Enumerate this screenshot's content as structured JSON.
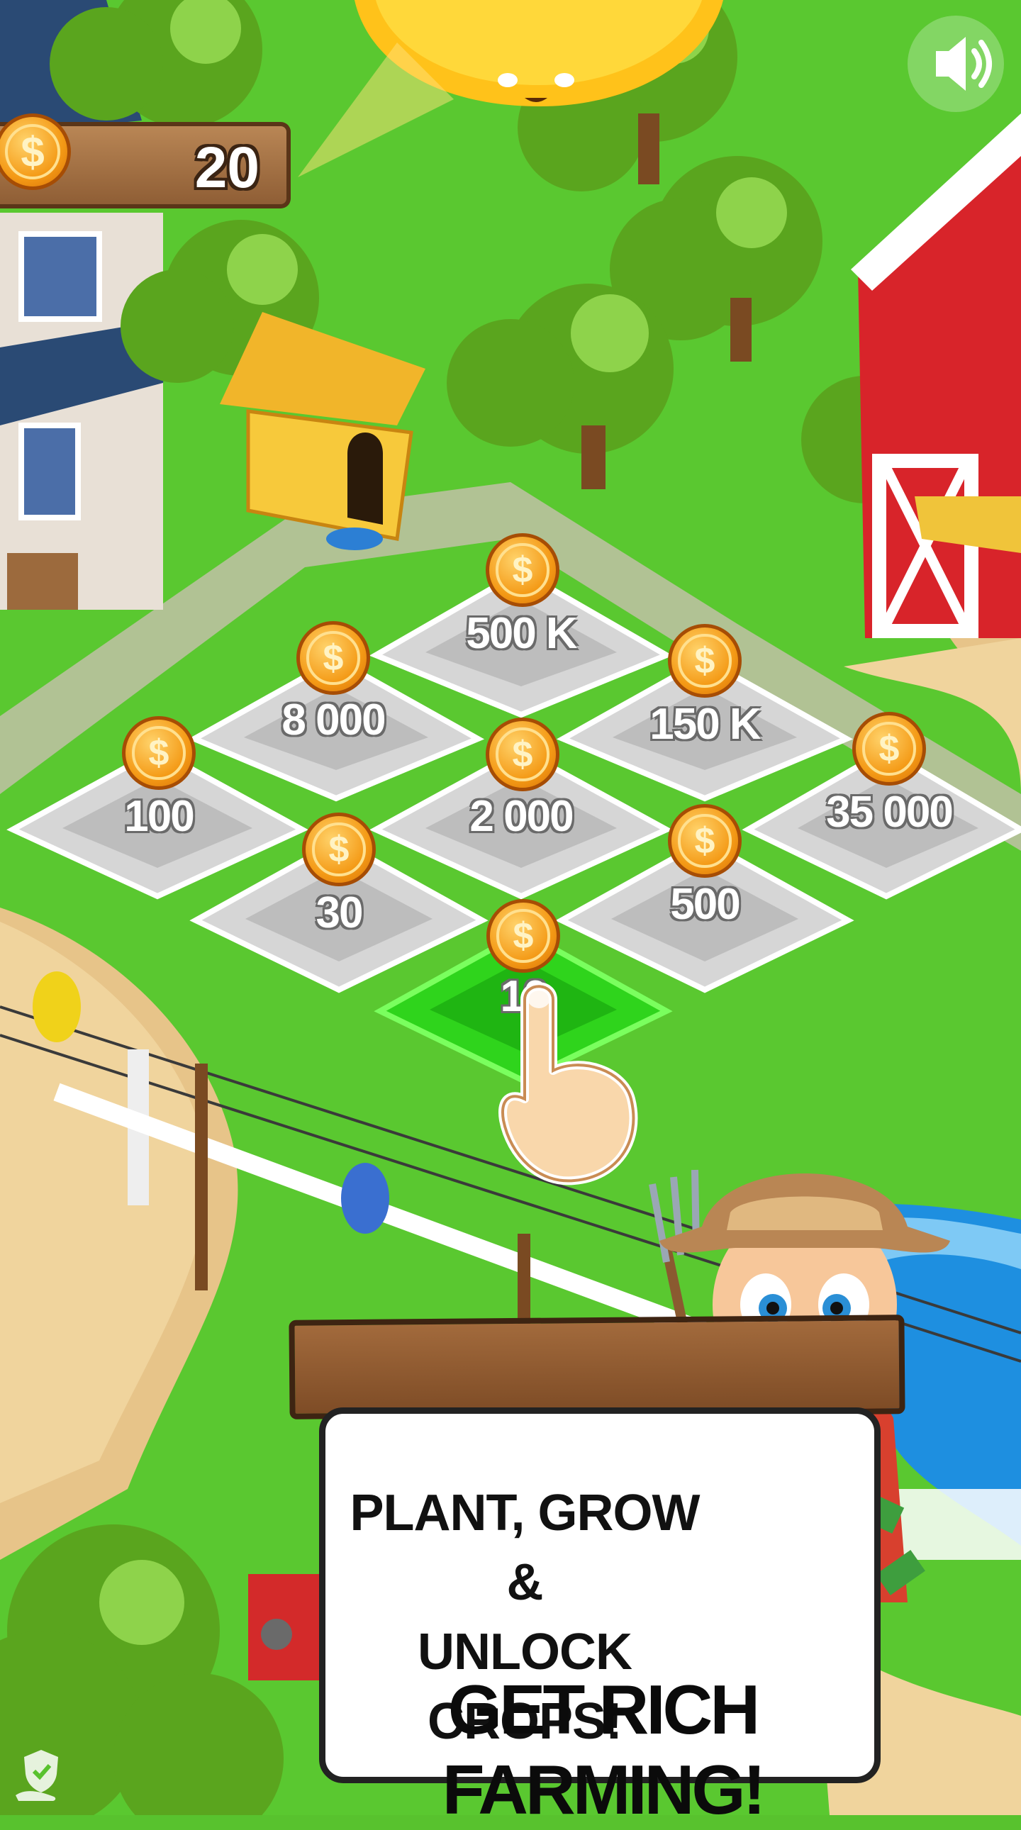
{
  "hud": {
    "coins": "20",
    "coin_icon": "coin-dollar-icon",
    "sound_icon": "speaker-icon"
  },
  "plots": [
    {
      "label": "500 K",
      "state": "locked"
    },
    {
      "label": "8 000",
      "state": "locked"
    },
    {
      "label": "150 K",
      "state": "locked"
    },
    {
      "label": "100",
      "state": "locked"
    },
    {
      "label": "2 000",
      "state": "locked"
    },
    {
      "label": "35 000",
      "state": "locked"
    },
    {
      "label": "30",
      "state": "locked"
    },
    {
      "label": "500",
      "state": "locked"
    },
    {
      "label": "10",
      "state": "highlighted"
    }
  ],
  "sign": {
    "subtitle_line1": "PLANT, GROW &",
    "subtitle_line2": "UNLOCK CROPS!",
    "title": "GET RICH FARMING!"
  },
  "colors": {
    "grass": "#58c22e",
    "plot": "#c9c9c9",
    "highlight_plot": "#2fd41c",
    "coin": "#f49a16",
    "barn": "#d8242a",
    "water": "#1e8fe0"
  }
}
